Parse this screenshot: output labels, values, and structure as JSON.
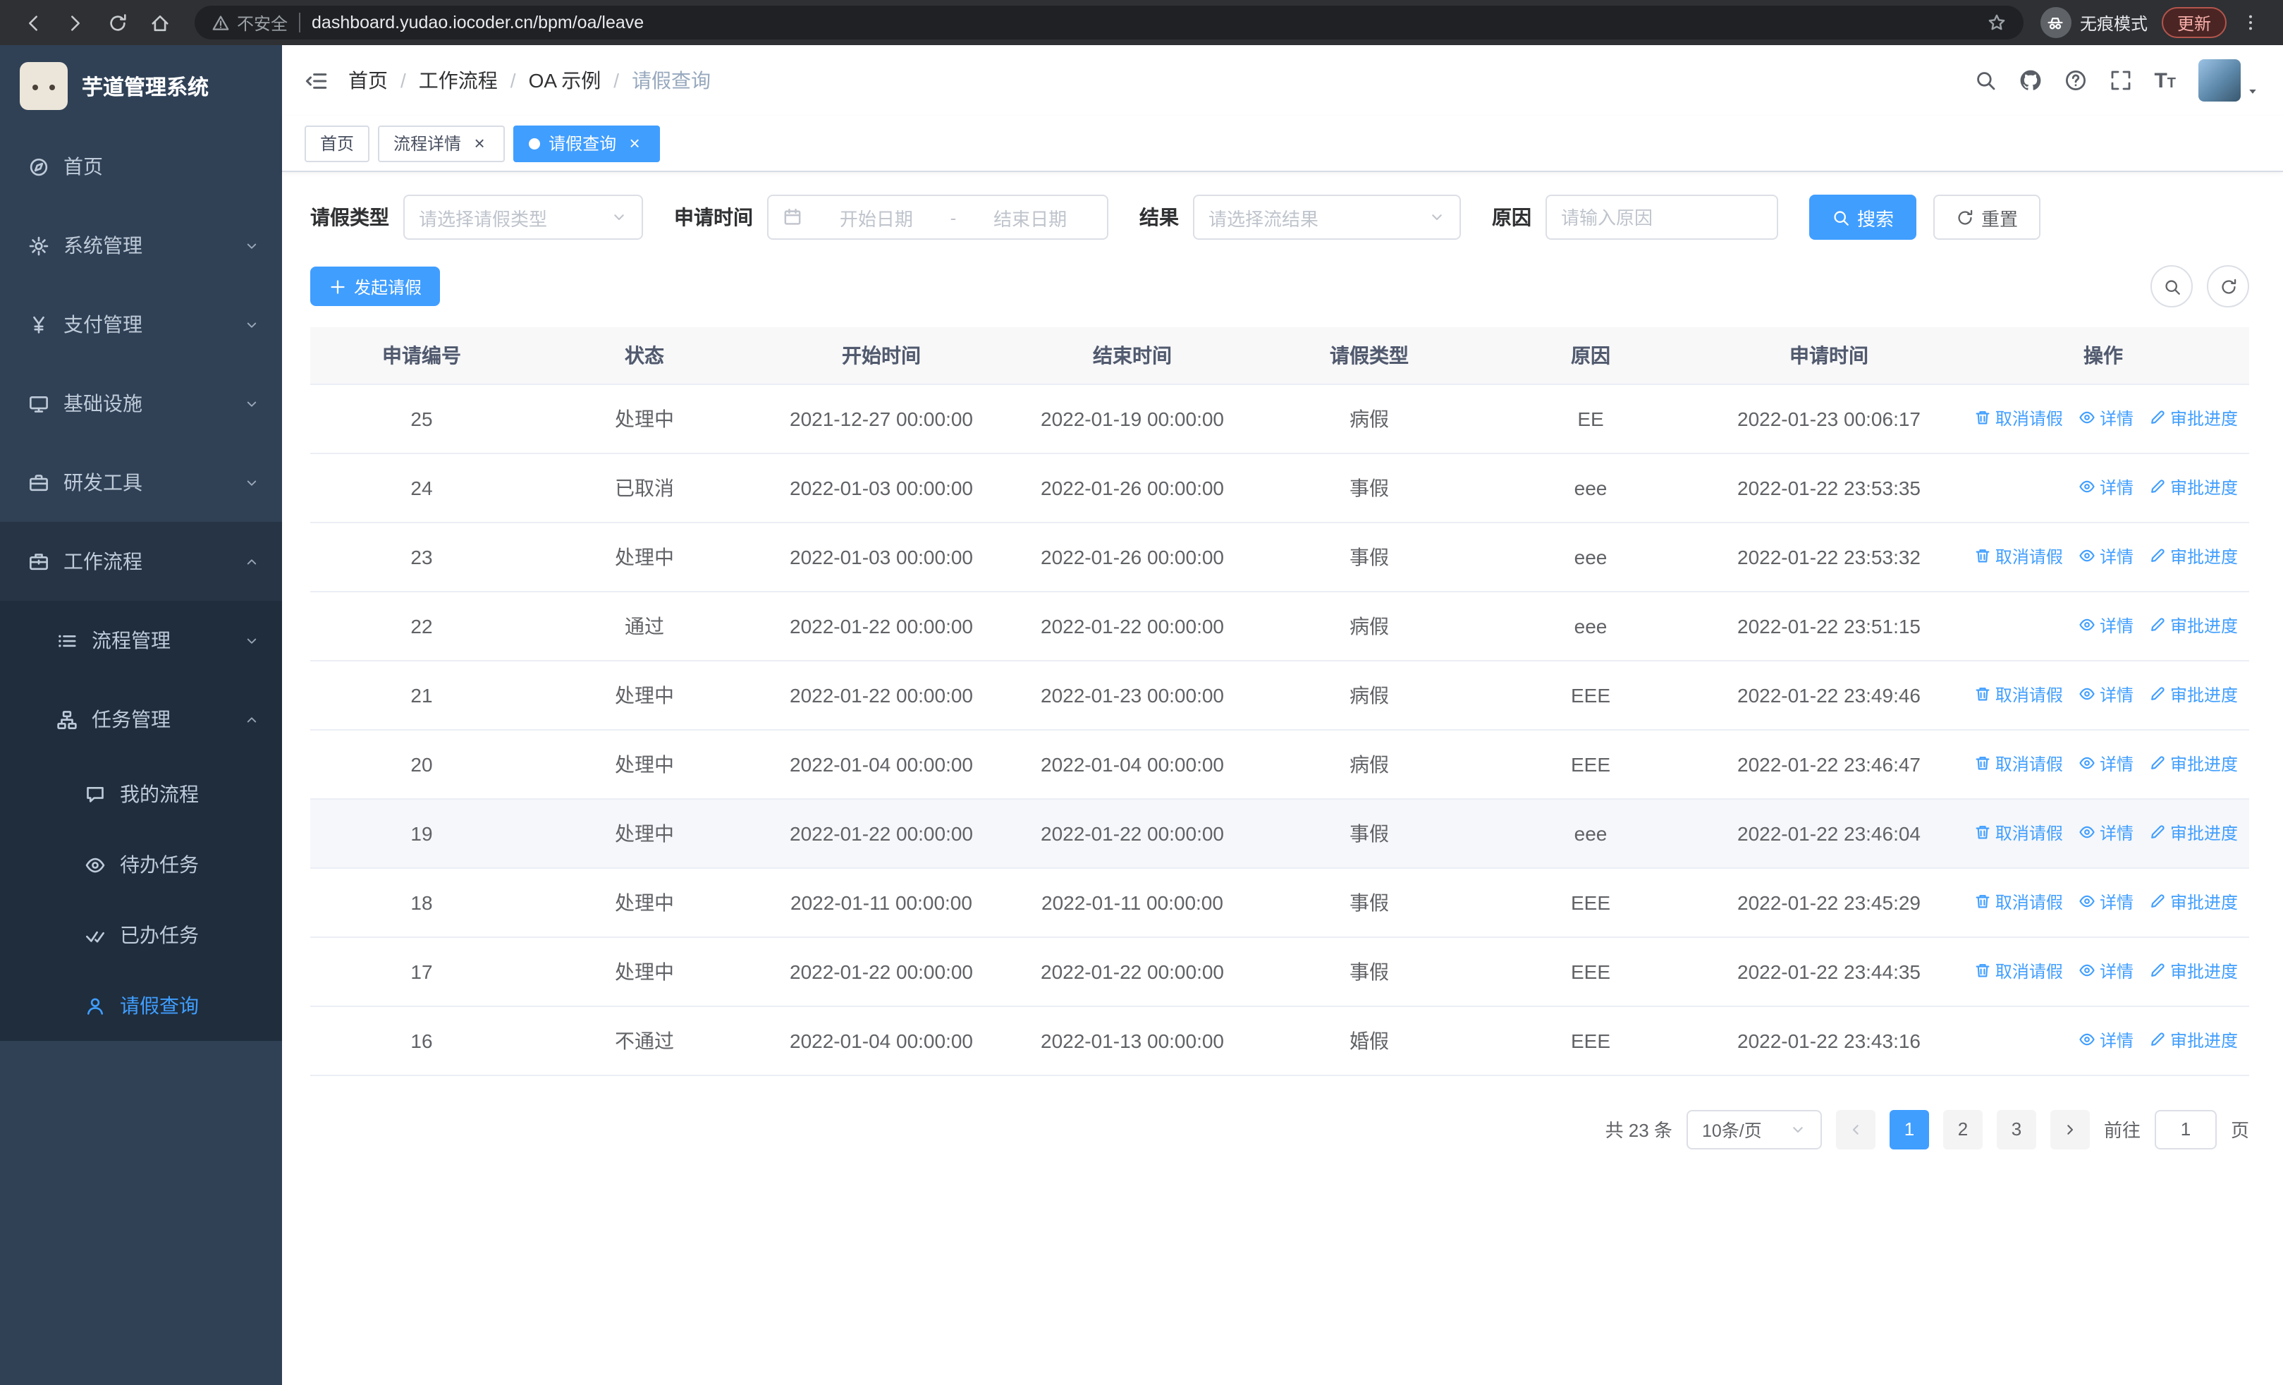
{
  "browser": {
    "security_label": "不安全",
    "url": "dashboard.yudao.iocoder.cn/bpm/oa/leave",
    "incognito_label": "无痕模式",
    "update_label": "更新"
  },
  "sidebar": {
    "app_title": "芋道管理系统",
    "items": [
      {
        "id": "home",
        "label": "首页",
        "icon": "dashboard-icon",
        "level": 1
      },
      {
        "id": "system",
        "label": "系统管理",
        "icon": "gear-icon",
        "level": 1,
        "chevron": "down"
      },
      {
        "id": "payment",
        "label": "支付管理",
        "icon": "yen-icon",
        "level": 1,
        "chevron": "down"
      },
      {
        "id": "infrastructure",
        "label": "基础设施",
        "icon": "monitor-icon",
        "level": 1,
        "chevron": "down"
      },
      {
        "id": "devtools",
        "label": "研发工具",
        "icon": "toolbox-icon",
        "level": 1,
        "chevron": "down"
      },
      {
        "id": "workflow",
        "label": "工作流程",
        "icon": "workflow-icon",
        "level": 1,
        "chevron": "up",
        "open": true
      },
      {
        "id": "process-mgmt",
        "label": "流程管理",
        "icon": "process-icon",
        "level": 2,
        "chevron": "down"
      },
      {
        "id": "task-mgmt",
        "label": "任务管理",
        "icon": "task-icon",
        "level": 2,
        "chevron": "up",
        "open": true
      },
      {
        "id": "my-process",
        "label": "我的流程",
        "icon": "chat-icon",
        "level": 3
      },
      {
        "id": "todo-task",
        "label": "待办任务",
        "icon": "eye-icon",
        "level": 3
      },
      {
        "id": "done-task",
        "label": "已办任务",
        "icon": "done-icon",
        "level": 3
      },
      {
        "id": "leave-query",
        "label": "请假查询",
        "icon": "user-icon",
        "level": 3,
        "active": true
      }
    ]
  },
  "header": {
    "breadcrumb": [
      "首页",
      "工作流程",
      "OA 示例",
      "请假查询"
    ]
  },
  "tabs": [
    {
      "id": "home",
      "label": "首页"
    },
    {
      "id": "process-detail",
      "label": "流程详情",
      "closable": true
    },
    {
      "id": "leave-query",
      "label": "请假查询",
      "closable": true,
      "active": true
    }
  ],
  "filters": {
    "leave_type": {
      "label": "请假类型",
      "placeholder": "请选择请假类型"
    },
    "apply_time": {
      "label": "申请时间",
      "start_placeholder": "开始日期",
      "separator": "-",
      "end_placeholder": "结束日期"
    },
    "result": {
      "label": "结果",
      "placeholder": "请选择流结果"
    },
    "reason": {
      "label": "原因",
      "placeholder": "请输入原因"
    },
    "search_label": "搜索",
    "reset_label": "重置"
  },
  "toolbar": {
    "create_label": "发起请假"
  },
  "table": {
    "columns": [
      "申请编号",
      "状态",
      "开始时间",
      "结束时间",
      "请假类型",
      "原因",
      "申请时间",
      "操作"
    ],
    "action_types": {
      "cancel": {
        "label": "取消请假",
        "icon": "trash-icon"
      },
      "detail": {
        "label": "详情",
        "icon": "eye-icon"
      },
      "progress": {
        "label": "审批进度",
        "icon": "edit-icon"
      }
    },
    "rows": [
      {
        "id": "25",
        "status": "处理中",
        "start_time": "2021-12-27 00:00:00",
        "end_time": "2022-01-19 00:00:00",
        "leave_type": "病假",
        "reason": "EE",
        "apply_time": "2022-01-23 00:06:17",
        "actions": [
          "cancel",
          "detail",
          "progress"
        ]
      },
      {
        "id": "24",
        "status": "已取消",
        "start_time": "2022-01-03 00:00:00",
        "end_time": "2022-01-26 00:00:00",
        "leave_type": "事假",
        "reason": "eee",
        "apply_time": "2022-01-22 23:53:35",
        "actions": [
          "detail",
          "progress"
        ]
      },
      {
        "id": "23",
        "status": "处理中",
        "start_time": "2022-01-03 00:00:00",
        "end_time": "2022-01-26 00:00:00",
        "leave_type": "事假",
        "reason": "eee",
        "apply_time": "2022-01-22 23:53:32",
        "actions": [
          "cancel",
          "detail",
          "progress"
        ]
      },
      {
        "id": "22",
        "status": "通过",
        "start_time": "2022-01-22 00:00:00",
        "end_time": "2022-01-22 00:00:00",
        "leave_type": "病假",
        "reason": "eee",
        "apply_time": "2022-01-22 23:51:15",
        "actions": [
          "detail",
          "progress"
        ]
      },
      {
        "id": "21",
        "status": "处理中",
        "start_time": "2022-01-22 00:00:00",
        "end_time": "2022-01-23 00:00:00",
        "leave_type": "病假",
        "reason": "EEE",
        "apply_time": "2022-01-22 23:49:46",
        "actions": [
          "cancel",
          "detail",
          "progress"
        ]
      },
      {
        "id": "20",
        "status": "处理中",
        "start_time": "2022-01-04 00:00:00",
        "end_time": "2022-01-04 00:00:00",
        "leave_type": "病假",
        "reason": "EEE",
        "apply_time": "2022-01-22 23:46:47",
        "actions": [
          "cancel",
          "detail",
          "progress"
        ]
      },
      {
        "id": "19",
        "status": "处理中",
        "start_time": "2022-01-22 00:00:00",
        "end_time": "2022-01-22 00:00:00",
        "leave_type": "事假",
        "reason": "eee",
        "apply_time": "2022-01-22 23:46:04",
        "actions": [
          "cancel",
          "detail",
          "progress"
        ],
        "highlighted": true
      },
      {
        "id": "18",
        "status": "处理中",
        "start_time": "2022-01-11 00:00:00",
        "end_time": "2022-01-11 00:00:00",
        "leave_type": "事假",
        "reason": "EEE",
        "apply_time": "2022-01-22 23:45:29",
        "actions": [
          "cancel",
          "detail",
          "progress"
        ]
      },
      {
        "id": "17",
        "status": "处理中",
        "start_time": "2022-01-22 00:00:00",
        "end_time": "2022-01-22 00:00:00",
        "leave_type": "事假",
        "reason": "EEE",
        "apply_time": "2022-01-22 23:44:35",
        "actions": [
          "cancel",
          "detail",
          "progress"
        ]
      },
      {
        "id": "16",
        "status": "不通过",
        "start_time": "2022-01-04 00:00:00",
        "end_time": "2022-01-13 00:00:00",
        "leave_type": "婚假",
        "reason": "EEE",
        "apply_time": "2022-01-22 23:43:16",
        "actions": [
          "detail",
          "progress"
        ]
      }
    ]
  },
  "pagination": {
    "total_label": "共 23 条",
    "page_size_value": "10条/页",
    "pages": [
      "1",
      "2",
      "3"
    ],
    "active_page": "1",
    "goto_label": "前往",
    "goto_value": "1",
    "goto_suffix": "页"
  },
  "colors": {
    "accent": "#409eff",
    "sidebar_bg": "#304156",
    "submenu_bg": "#1f2d3d",
    "table_header_bg": "#f8f8f9"
  }
}
